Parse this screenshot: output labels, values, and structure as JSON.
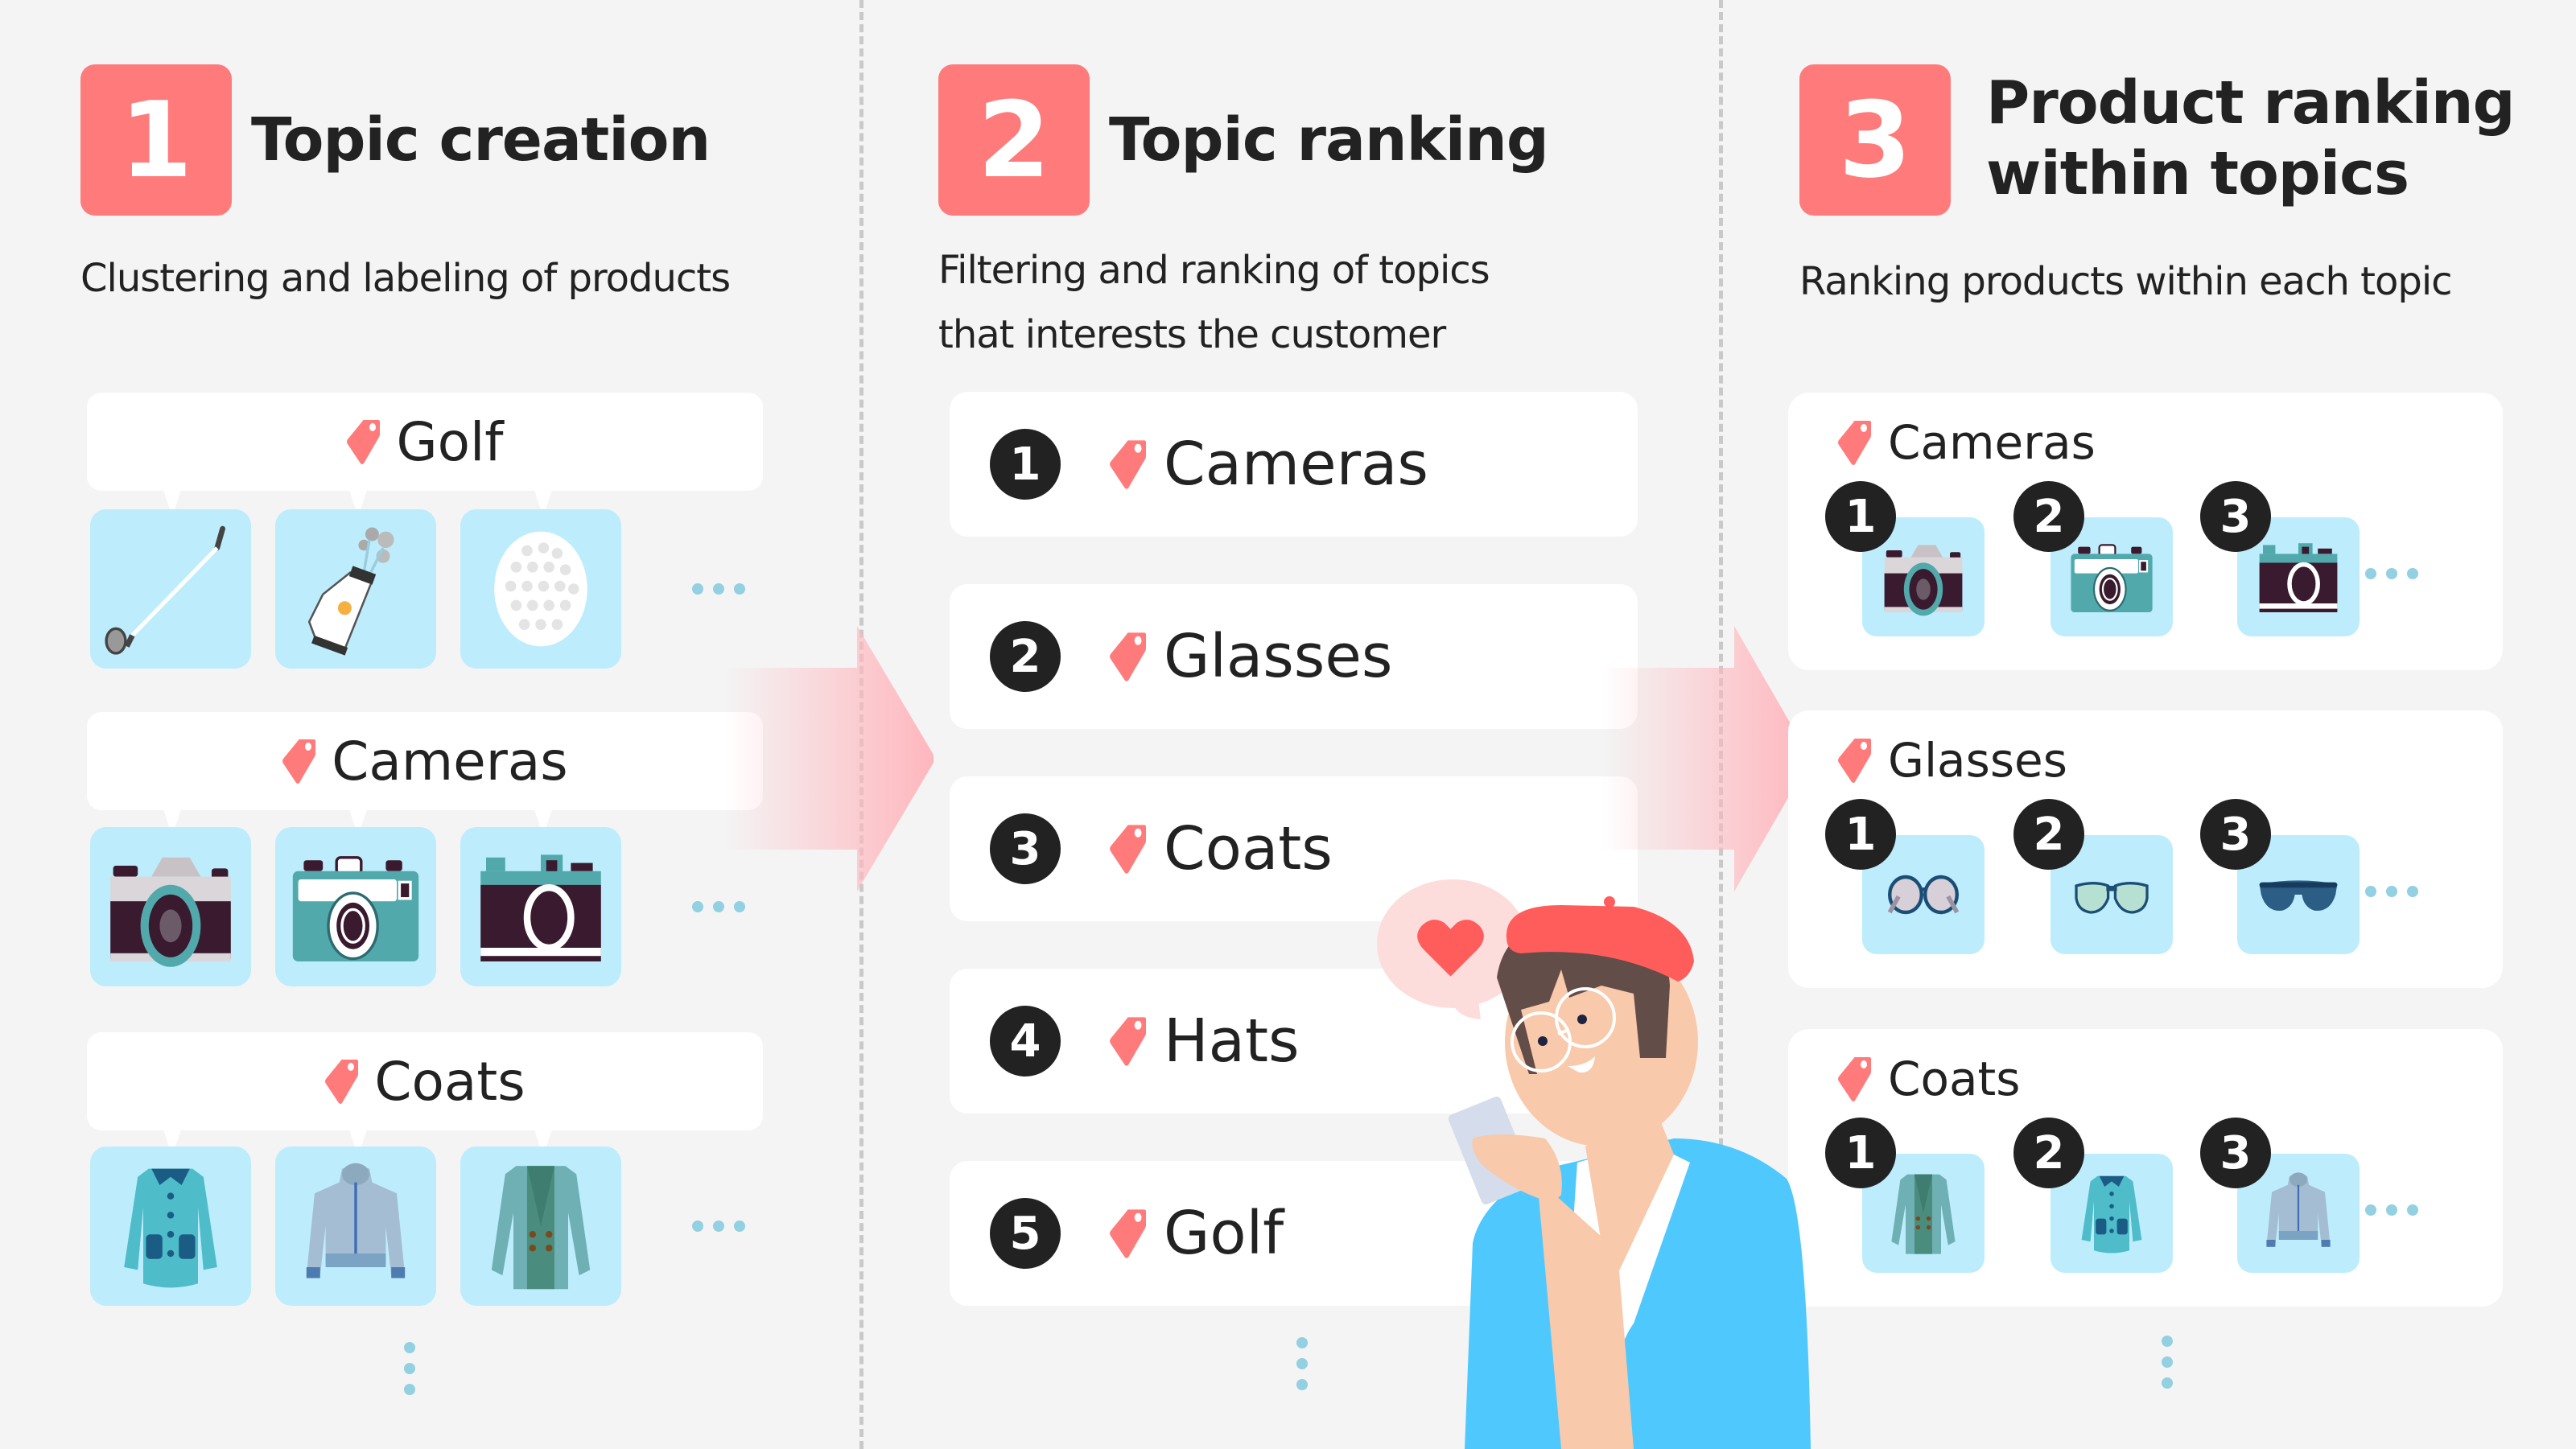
{
  "colors": {
    "background": "#f4f4f4",
    "accent": "#ff7b7b",
    "tile": "#bdedfc",
    "rank_badge": "#222222",
    "dots": "#92d0e2",
    "arrow": "#ffb6bd"
  },
  "steps": [
    {
      "number": "1",
      "title": "Topic creation",
      "description": "Clustering and labeling of products",
      "topics": [
        {
          "label": "Golf",
          "icon": "tag-icon",
          "products": [
            "golf-club-icon",
            "golf-bag-icon",
            "golf-ball-icon"
          ],
          "more": "..."
        },
        {
          "label": "Cameras",
          "icon": "tag-icon",
          "products": [
            "slr-camera-icon",
            "teal-camera-icon",
            "dark-camera-icon"
          ],
          "more": "..."
        },
        {
          "label": "Coats",
          "icon": "tag-icon",
          "products": [
            "teal-coat-icon",
            "grey-jacket-icon",
            "green-coat-icon"
          ],
          "more": "..."
        }
      ],
      "continuation": "more-topics-indicator"
    },
    {
      "number": "2",
      "title": "Topic ranking",
      "description_lines": [
        "Filtering and ranking of topics",
        "that interests the customer"
      ],
      "ranked_topics": [
        {
          "rank": "1",
          "label": "Cameras"
        },
        {
          "rank": "2",
          "label": "Glasses"
        },
        {
          "rank": "3",
          "label": "Coats"
        },
        {
          "rank": "4",
          "label": "Hats"
        },
        {
          "rank": "5",
          "label": "Golf"
        }
      ],
      "continuation": "more-topics-indicator"
    },
    {
      "number": "3",
      "title_lines": [
        "Product ranking",
        "within topics"
      ],
      "description": "Ranking products within each topic",
      "groups": [
        {
          "label": "Cameras",
          "items": [
            {
              "rank": "1",
              "product": "slr-camera-icon"
            },
            {
              "rank": "2",
              "product": "teal-camera-icon"
            },
            {
              "rank": "3",
              "product": "dark-camera-icon"
            }
          ]
        },
        {
          "label": "Glasses",
          "items": [
            {
              "rank": "1",
              "product": "round-glasses-icon"
            },
            {
              "rank": "2",
              "product": "green-glasses-icon"
            },
            {
              "rank": "3",
              "product": "sunglasses-icon"
            }
          ]
        },
        {
          "label": "Coats",
          "items": [
            {
              "rank": "1",
              "product": "green-coat-icon"
            },
            {
              "rank": "2",
              "product": "teal-coat-icon"
            },
            {
              "rank": "3",
              "product": "grey-jacket-icon"
            }
          ]
        }
      ],
      "continuation": "more-groups-indicator"
    }
  ],
  "illustration": {
    "subject": "customer-with-phone",
    "speech_bubble_icon": "heart-icon"
  }
}
